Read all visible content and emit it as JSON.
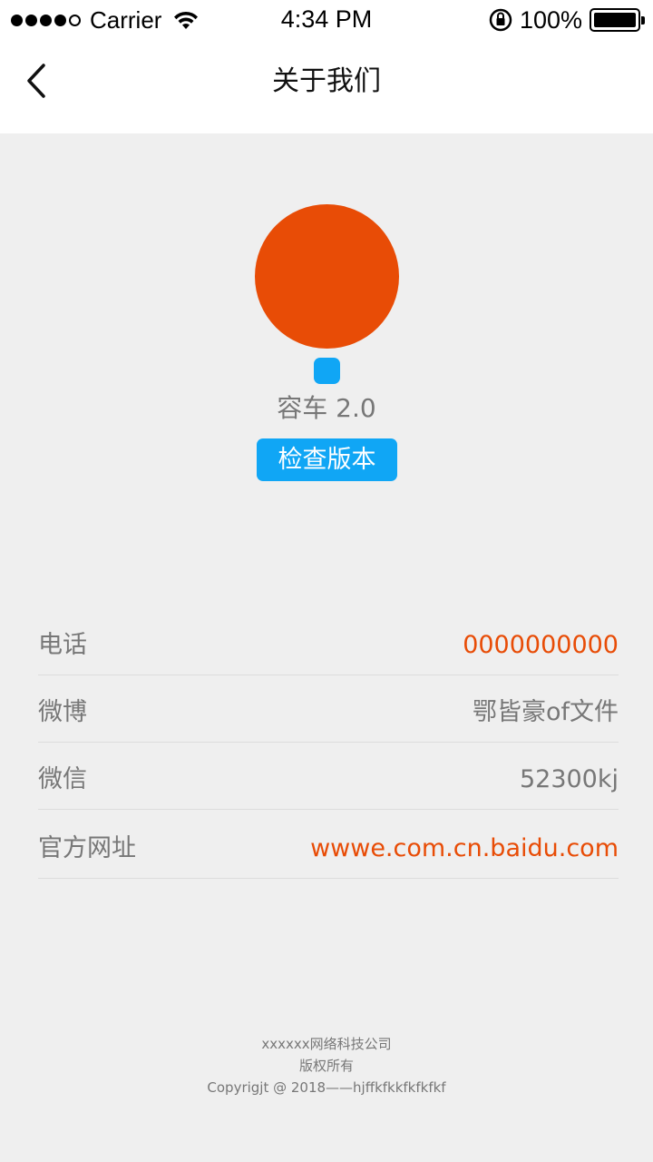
{
  "status_bar": {
    "carrier": "Carrier",
    "time": "4:34 PM",
    "battery_percent": "100%",
    "signal_bars_filled": 4,
    "signal_bars_total": 5
  },
  "nav": {
    "title": "关于我们",
    "back_icon": "chevron-left-icon"
  },
  "app": {
    "name_version": "容车  2.0",
    "check_button_label": "检查版本",
    "logo_color": "#e84c06",
    "badge_color": "#10a6f5"
  },
  "info": [
    {
      "label": "电话",
      "value": "0000000000",
      "accent": true
    },
    {
      "label": "微博",
      "value": "鄂皆豪of文件",
      "accent": false
    },
    {
      "label": "微信",
      "value": "52300kj",
      "accent": false
    },
    {
      "label": "官方网址",
      "value": "wwwe.com.cn.baidu.com",
      "accent": true
    }
  ],
  "footer": {
    "company": "xxxxxx网络科技公司",
    "rights": "版权所有",
    "copyright": "Copyrigjt  @  2018——hjffkfkkfkfkfkf"
  },
  "colors": {
    "accent": "#e84c06",
    "primary": "#10a6f5",
    "background": "#efefef"
  }
}
